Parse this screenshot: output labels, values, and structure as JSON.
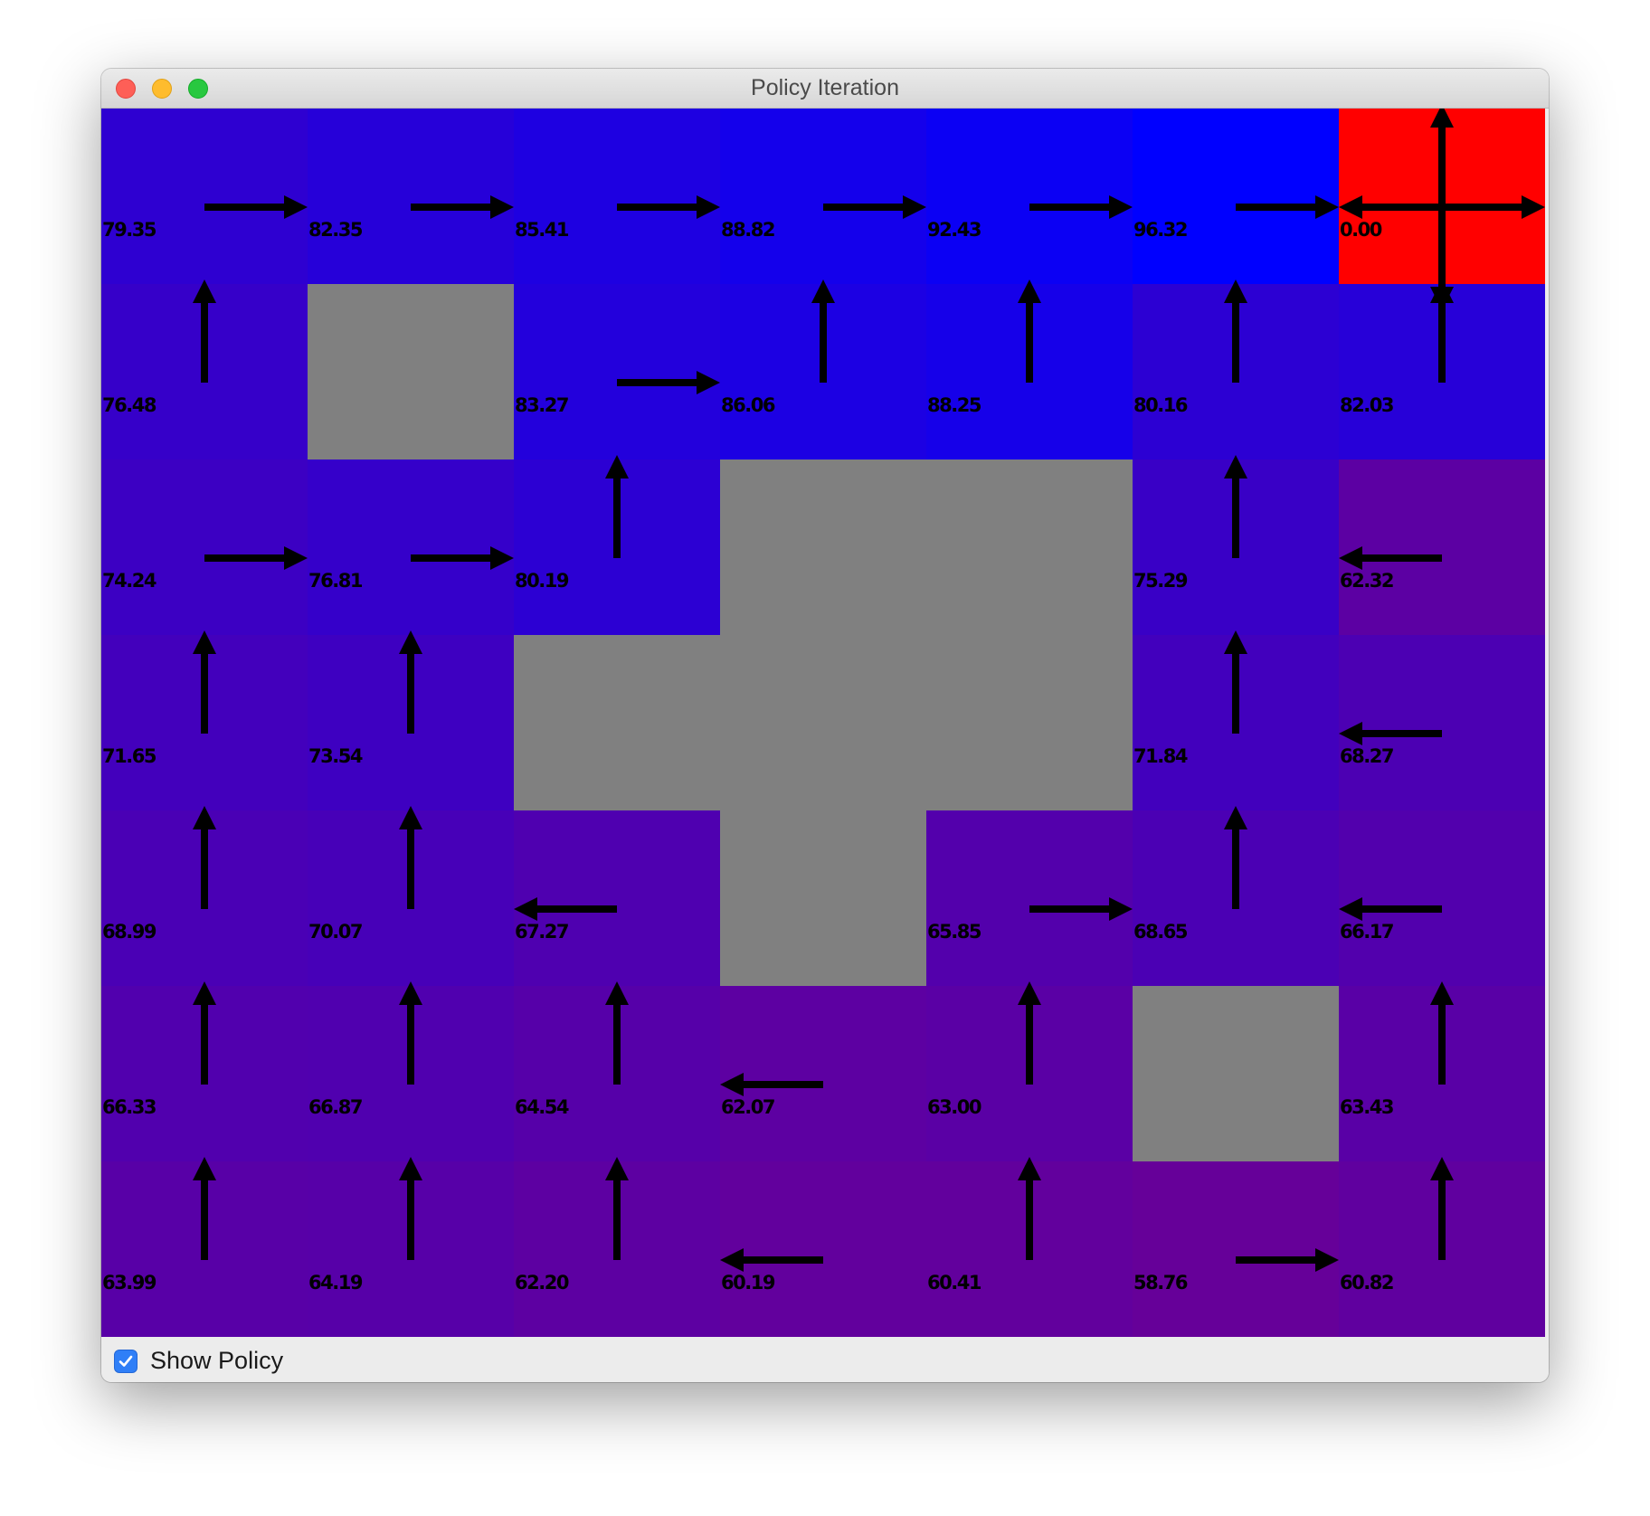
{
  "window": {
    "title": "Policy Iteration"
  },
  "gridworld": {
    "rows": 7,
    "cols": 7,
    "colors": {
      "wall": "#808080",
      "goal": "#ff0000",
      "value_high": "#0000ff",
      "value_low": "#660099",
      "arrow": "#000000"
    },
    "value_scale": {
      "min": 58.76,
      "max": 96.32
    },
    "cells": [
      [
        {
          "type": "state",
          "value": "79.35",
          "policy": "right"
        },
        {
          "type": "state",
          "value": "82.35",
          "policy": "right"
        },
        {
          "type": "state",
          "value": "85.41",
          "policy": "right"
        },
        {
          "type": "state",
          "value": "88.82",
          "policy": "right"
        },
        {
          "type": "state",
          "value": "92.43",
          "policy": "right"
        },
        {
          "type": "state",
          "value": "96.32",
          "policy": "right"
        },
        {
          "type": "goal",
          "value": "0.00",
          "policy": "all"
        }
      ],
      [
        {
          "type": "state",
          "value": "76.48",
          "policy": "up"
        },
        {
          "type": "wall"
        },
        {
          "type": "state",
          "value": "83.27",
          "policy": "right"
        },
        {
          "type": "state",
          "value": "86.06",
          "policy": "up"
        },
        {
          "type": "state",
          "value": "88.25",
          "policy": "up"
        },
        {
          "type": "state",
          "value": "80.16",
          "policy": "up"
        },
        {
          "type": "state",
          "value": "82.03",
          "policy": "up"
        }
      ],
      [
        {
          "type": "state",
          "value": "74.24",
          "policy": "right"
        },
        {
          "type": "state",
          "value": "76.81",
          "policy": "right"
        },
        {
          "type": "state",
          "value": "80.19",
          "policy": "up"
        },
        {
          "type": "wall"
        },
        {
          "type": "wall"
        },
        {
          "type": "state",
          "value": "75.29",
          "policy": "up"
        },
        {
          "type": "state",
          "value": "62.32",
          "policy": "left"
        }
      ],
      [
        {
          "type": "state",
          "value": "71.65",
          "policy": "up"
        },
        {
          "type": "state",
          "value": "73.54",
          "policy": "up"
        },
        {
          "type": "wall"
        },
        {
          "type": "wall"
        },
        {
          "type": "wall"
        },
        {
          "type": "state",
          "value": "71.84",
          "policy": "up"
        },
        {
          "type": "state",
          "value": "68.27",
          "policy": "left"
        }
      ],
      [
        {
          "type": "state",
          "value": "68.99",
          "policy": "up"
        },
        {
          "type": "state",
          "value": "70.07",
          "policy": "up"
        },
        {
          "type": "state",
          "value": "67.27",
          "policy": "left"
        },
        {
          "type": "wall"
        },
        {
          "type": "state",
          "value": "65.85",
          "policy": "right"
        },
        {
          "type": "state",
          "value": "68.65",
          "policy": "up"
        },
        {
          "type": "state",
          "value": "66.17",
          "policy": "left"
        }
      ],
      [
        {
          "type": "state",
          "value": "66.33",
          "policy": "up"
        },
        {
          "type": "state",
          "value": "66.87",
          "policy": "up"
        },
        {
          "type": "state",
          "value": "64.54",
          "policy": "up"
        },
        {
          "type": "state",
          "value": "62.07",
          "policy": "left"
        },
        {
          "type": "state",
          "value": "63.00",
          "policy": "up"
        },
        {
          "type": "wall"
        },
        {
          "type": "state",
          "value": "63.43",
          "policy": "up"
        }
      ],
      [
        {
          "type": "state",
          "value": "63.99",
          "policy": "up"
        },
        {
          "type": "state",
          "value": "64.19",
          "policy": "up"
        },
        {
          "type": "state",
          "value": "62.20",
          "policy": "up"
        },
        {
          "type": "state",
          "value": "60.19",
          "policy": "left"
        },
        {
          "type": "state",
          "value": "60.41",
          "policy": "up"
        },
        {
          "type": "state",
          "value": "58.76",
          "policy": "right"
        },
        {
          "type": "state",
          "value": "60.82",
          "policy": "up"
        }
      ]
    ]
  },
  "controls": {
    "show_policy": {
      "label": "Show Policy",
      "checked": true
    }
  }
}
